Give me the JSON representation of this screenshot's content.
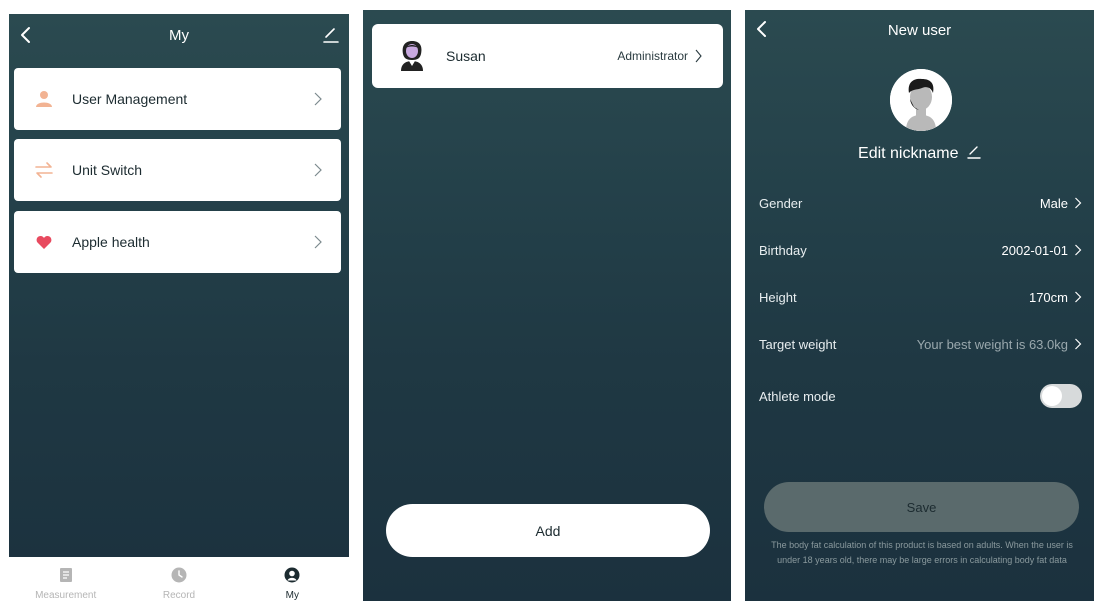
{
  "screen1": {
    "title": "My",
    "items": [
      {
        "label": "User Management",
        "icon": "person-icon",
        "color": "#f2b393"
      },
      {
        "label": "Unit Switch",
        "icon": "swap-arrows-icon",
        "color": "#f2b393"
      },
      {
        "label": "Apple health",
        "icon": "heart-icon",
        "color": "#e84a5f"
      }
    ],
    "tabs": [
      {
        "label": "Measurement",
        "icon": "document-icon"
      },
      {
        "label": "Record",
        "icon": "clock-icon"
      },
      {
        "label": "My",
        "icon": "user-icon",
        "active": true
      }
    ]
  },
  "screen2": {
    "user": {
      "name": "Susan",
      "role": "Administrator"
    },
    "add_label": "Add"
  },
  "screen3": {
    "title": "New user",
    "nickname": "Edit nickname",
    "rows": [
      {
        "key": "Gender",
        "value": "Male"
      },
      {
        "key": "Birthday",
        "value": "2002-01-01"
      },
      {
        "key": "Height",
        "value": "170cm"
      },
      {
        "key": "Target weight",
        "value": "Your best weight is 63.0kg"
      }
    ],
    "athlete_label": "Athlete mode",
    "athlete_on": false,
    "save_label": "Save",
    "note": "The body fat calculation of this product is based on adults. When the user is under 18 years old, there may be large errors in calculating body fat data"
  }
}
